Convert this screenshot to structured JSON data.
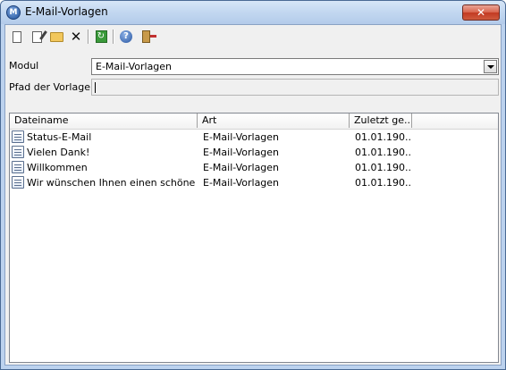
{
  "window": {
    "title": "E-Mail-Vorlagen",
    "close_glyph": "✕",
    "app_icon_letter": "M"
  },
  "toolbar": {
    "buttons": [
      {
        "icon": "new-document-icon"
      },
      {
        "icon": "edit-icon"
      },
      {
        "icon": "open-folder-icon"
      },
      {
        "icon": "delete-icon",
        "glyph": "✕"
      },
      {
        "icon": "refresh-icon",
        "glyph": "↻"
      },
      {
        "icon": "help-icon",
        "glyph": "?"
      },
      {
        "icon": "exit-icon"
      }
    ]
  },
  "form": {
    "modul_label": "Modul",
    "modul_value": "E-Mail-Vorlagen",
    "pfad_label": "Pfad der Vorlagen",
    "pfad_value": ""
  },
  "list": {
    "columns": [
      "Dateiname",
      "Art",
      "Zuletzt ge..."
    ],
    "rows": [
      {
        "name": "Status-E-Mail",
        "type": "E-Mail-Vorlagen",
        "modified": "01.01.190..."
      },
      {
        "name": "Vielen Dank!",
        "type": "E-Mail-Vorlagen",
        "modified": "01.01.190..."
      },
      {
        "name": "Willkommen",
        "type": "E-Mail-Vorlagen",
        "modified": "01.01.190..."
      },
      {
        "name": "Wir wünschen Ihnen einen schönen ...",
        "type": "E-Mail-Vorlagen",
        "modified": "01.01.190..."
      }
    ]
  },
  "colors": {
    "title_bar": "#c2d7f0",
    "close_button": "#c23a22",
    "client_bg": "#f0f0f0"
  }
}
